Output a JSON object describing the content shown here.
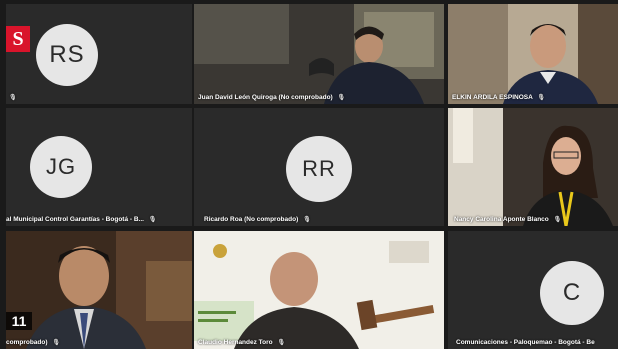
{
  "overlay": {
    "logo_letter": "S",
    "tile_counter": "11"
  },
  "participants": [
    {
      "initials": "RS",
      "name": "",
      "muted": true
    },
    {
      "initials": "",
      "name": "Juan David León Quiroga (No comprobado)",
      "muted": true
    },
    {
      "initials": "",
      "name": "ELKIN ARDILA ESPINOSA",
      "muted": true
    },
    {
      "initials": "JG",
      "name": "al Municipal Control Garantías - Bogotá - B...",
      "muted": true
    },
    {
      "initials": "RR",
      "name": "Ricardo Roa (No comprobado)",
      "muted": true
    },
    {
      "initials": "",
      "name": "Nancy Carolina Aponte Blanco",
      "muted": true
    },
    {
      "initials": "",
      "name": "comprobado)",
      "muted": true
    },
    {
      "initials": "",
      "name": "Claudio Hernandez Toro",
      "muted": true
    },
    {
      "initials": "C",
      "name": "Comunicaciones - Paloquemao - Bogotá - Be",
      "muted": true
    }
  ],
  "icons": {
    "mic_muted": "microphone-muted-icon"
  },
  "colors": {
    "tile_bg": "#262626",
    "avatar_bg": "#e6e6e6",
    "logo_red": "#d9142b"
  }
}
